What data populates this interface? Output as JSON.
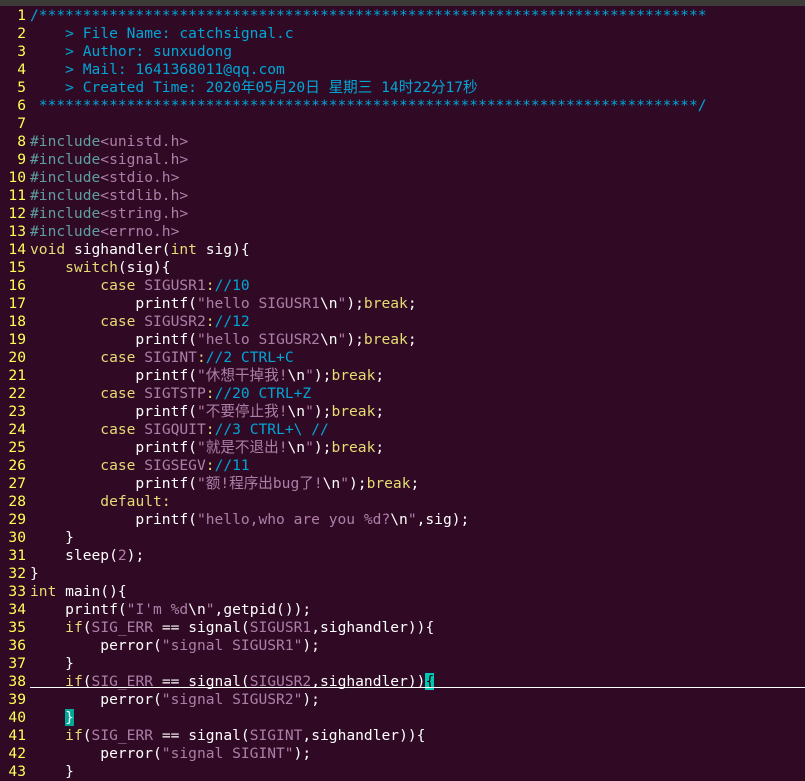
{
  "editor": {
    "lines": [
      {
        "n": "1",
        "tokens": [
          {
            "t": "/****************************************************************************",
            "c": "c"
          }
        ]
      },
      {
        "n": "2",
        "tokens": [
          {
            "t": "    > File Name: catchsignal.c",
            "c": "c"
          }
        ]
      },
      {
        "n": "3",
        "tokens": [
          {
            "t": "    > Author: sunxudong",
            "c": "c"
          }
        ]
      },
      {
        "n": "4",
        "tokens": [
          {
            "t": "    > Mail: 1641368011@qq.com",
            "c": "c"
          }
        ]
      },
      {
        "n": "5",
        "tokens": [
          {
            "t": "    > Created Time: 2020年05月20日 星期三 14时22分17秒",
            "c": "c"
          }
        ]
      },
      {
        "n": "6",
        "tokens": [
          {
            "t": " ***************************************************************************/",
            "c": "c"
          }
        ]
      },
      {
        "n": "7",
        "tokens": []
      },
      {
        "n": "8",
        "tokens": [
          {
            "t": "#include",
            "c": "p"
          },
          {
            "t": "<unistd.h>",
            "c": "s"
          }
        ]
      },
      {
        "n": "9",
        "tokens": [
          {
            "t": "#include",
            "c": "p"
          },
          {
            "t": "<signal.h>",
            "c": "s"
          }
        ]
      },
      {
        "n": "10",
        "tokens": [
          {
            "t": "#include",
            "c": "p"
          },
          {
            "t": "<stdio.h>",
            "c": "s"
          }
        ]
      },
      {
        "n": "11",
        "tokens": [
          {
            "t": "#include",
            "c": "p"
          },
          {
            "t": "<stdlib.h>",
            "c": "s"
          }
        ]
      },
      {
        "n": "12",
        "tokens": [
          {
            "t": "#include",
            "c": "p"
          },
          {
            "t": "<string.h>",
            "c": "s"
          }
        ]
      },
      {
        "n": "13",
        "tokens": [
          {
            "t": "#include",
            "c": "p"
          },
          {
            "t": "<errno.h>",
            "c": "s"
          }
        ]
      },
      {
        "n": "14",
        "tokens": [
          {
            "t": "void",
            "c": "k"
          },
          {
            "t": " sighandler(",
            "c": ""
          },
          {
            "t": "int",
            "c": "k"
          },
          {
            "t": " sig){",
            "c": ""
          }
        ]
      },
      {
        "n": "15",
        "tokens": [
          {
            "t": "    ",
            "c": ""
          },
          {
            "t": "switch",
            "c": "k"
          },
          {
            "t": "(sig){",
            "c": ""
          }
        ]
      },
      {
        "n": "16",
        "tokens": [
          {
            "t": "        ",
            "c": ""
          },
          {
            "t": "case",
            "c": "k"
          },
          {
            "t": " ",
            "c": ""
          },
          {
            "t": "SIGUSR1",
            "c": "s"
          },
          {
            "t": ":",
            "c": "k"
          },
          {
            "t": "//10",
            "c": "c"
          }
        ]
      },
      {
        "n": "17",
        "tokens": [
          {
            "t": "            printf(",
            "c": ""
          },
          {
            "t": "\"hello SIGUSR1",
            "c": "s"
          },
          {
            "t": "\\n",
            "c": ""
          },
          {
            "t": "\"",
            "c": "s"
          },
          {
            "t": ");",
            "c": ""
          },
          {
            "t": "break",
            "c": "k"
          },
          {
            "t": ";",
            "c": ""
          }
        ]
      },
      {
        "n": "18",
        "tokens": [
          {
            "t": "        ",
            "c": ""
          },
          {
            "t": "case",
            "c": "k"
          },
          {
            "t": " ",
            "c": ""
          },
          {
            "t": "SIGUSR2",
            "c": "s"
          },
          {
            "t": ":",
            "c": "k"
          },
          {
            "t": "//12",
            "c": "c"
          }
        ]
      },
      {
        "n": "19",
        "tokens": [
          {
            "t": "            printf(",
            "c": ""
          },
          {
            "t": "\"hello SIGUSR2",
            "c": "s"
          },
          {
            "t": "\\n",
            "c": ""
          },
          {
            "t": "\"",
            "c": "s"
          },
          {
            "t": ");",
            "c": ""
          },
          {
            "t": "break",
            "c": "k"
          },
          {
            "t": ";",
            "c": ""
          }
        ]
      },
      {
        "n": "20",
        "tokens": [
          {
            "t": "        ",
            "c": ""
          },
          {
            "t": "case",
            "c": "k"
          },
          {
            "t": " ",
            "c": ""
          },
          {
            "t": "SIGINT",
            "c": "s"
          },
          {
            "t": ":",
            "c": "k"
          },
          {
            "t": "//2 CTRL+C",
            "c": "c"
          }
        ]
      },
      {
        "n": "21",
        "tokens": [
          {
            "t": "            printf(",
            "c": ""
          },
          {
            "t": "\"休想干掉我!",
            "c": "s"
          },
          {
            "t": "\\n",
            "c": ""
          },
          {
            "t": "\"",
            "c": "s"
          },
          {
            "t": ");",
            "c": ""
          },
          {
            "t": "break",
            "c": "k"
          },
          {
            "t": ";",
            "c": ""
          }
        ]
      },
      {
        "n": "22",
        "tokens": [
          {
            "t": "        ",
            "c": ""
          },
          {
            "t": "case",
            "c": "k"
          },
          {
            "t": " ",
            "c": ""
          },
          {
            "t": "SIGTSTP",
            "c": "s"
          },
          {
            "t": ":",
            "c": "k"
          },
          {
            "t": "//20 CTRL+Z",
            "c": "c"
          }
        ]
      },
      {
        "n": "23",
        "tokens": [
          {
            "t": "            printf(",
            "c": ""
          },
          {
            "t": "\"不要停止我!",
            "c": "s"
          },
          {
            "t": "\\n",
            "c": ""
          },
          {
            "t": "\"",
            "c": "s"
          },
          {
            "t": ");",
            "c": ""
          },
          {
            "t": "break",
            "c": "k"
          },
          {
            "t": ";",
            "c": ""
          }
        ]
      },
      {
        "n": "24",
        "tokens": [
          {
            "t": "        ",
            "c": ""
          },
          {
            "t": "case",
            "c": "k"
          },
          {
            "t": " ",
            "c": ""
          },
          {
            "t": "SIGQUIT",
            "c": "s"
          },
          {
            "t": ":",
            "c": "k"
          },
          {
            "t": "//3 CTRL+\\ //",
            "c": "c"
          }
        ]
      },
      {
        "n": "25",
        "tokens": [
          {
            "t": "            printf(",
            "c": ""
          },
          {
            "t": "\"就是不退出!",
            "c": "s"
          },
          {
            "t": "\\n",
            "c": ""
          },
          {
            "t": "\"",
            "c": "s"
          },
          {
            "t": ");",
            "c": ""
          },
          {
            "t": "break",
            "c": "k"
          },
          {
            "t": ";",
            "c": ""
          }
        ]
      },
      {
        "n": "26",
        "tokens": [
          {
            "t": "        ",
            "c": ""
          },
          {
            "t": "case",
            "c": "k"
          },
          {
            "t": " ",
            "c": ""
          },
          {
            "t": "SIGSEGV",
            "c": "s"
          },
          {
            "t": ":",
            "c": "k"
          },
          {
            "t": "//11",
            "c": "c"
          }
        ]
      },
      {
        "n": "27",
        "tokens": [
          {
            "t": "            printf(",
            "c": ""
          },
          {
            "t": "\"额!程序出bug了!",
            "c": "s"
          },
          {
            "t": "\\n",
            "c": ""
          },
          {
            "t": "\"",
            "c": "s"
          },
          {
            "t": ");",
            "c": ""
          },
          {
            "t": "break",
            "c": "k"
          },
          {
            "t": ";",
            "c": ""
          }
        ]
      },
      {
        "n": "28",
        "tokens": [
          {
            "t": "        ",
            "c": ""
          },
          {
            "t": "default",
            "c": "k"
          },
          {
            "t": ":",
            "c": "k"
          }
        ]
      },
      {
        "n": "29",
        "tokens": [
          {
            "t": "            printf(",
            "c": ""
          },
          {
            "t": "\"hello,who are you %d?",
            "c": "s"
          },
          {
            "t": "\\n",
            "c": ""
          },
          {
            "t": "\"",
            "c": "s"
          },
          {
            "t": ",sig);",
            "c": ""
          }
        ]
      },
      {
        "n": "30",
        "tokens": [
          {
            "t": "    }",
            "c": ""
          }
        ]
      },
      {
        "n": "31",
        "tokens": [
          {
            "t": "    sleep(",
            "c": ""
          },
          {
            "t": "2",
            "c": "n"
          },
          {
            "t": ");",
            "c": ""
          }
        ]
      },
      {
        "n": "32",
        "tokens": [
          {
            "t": "}",
            "c": ""
          }
        ]
      },
      {
        "n": "33",
        "tokens": [
          {
            "t": "int",
            "c": "k"
          },
          {
            "t": " main(){",
            "c": ""
          }
        ]
      },
      {
        "n": "34",
        "tokens": [
          {
            "t": "    printf(",
            "c": ""
          },
          {
            "t": "\"I'm %d",
            "c": "s"
          },
          {
            "t": "\\n",
            "c": ""
          },
          {
            "t": "\"",
            "c": "s"
          },
          {
            "t": ",getpid());",
            "c": ""
          }
        ]
      },
      {
        "n": "35",
        "tokens": [
          {
            "t": "    ",
            "c": ""
          },
          {
            "t": "if",
            "c": "k"
          },
          {
            "t": "(",
            "c": ""
          },
          {
            "t": "SIG_ERR",
            "c": "s"
          },
          {
            "t": " == signal(",
            "c": ""
          },
          {
            "t": "SIGUSR1",
            "c": "s"
          },
          {
            "t": ",sighandler)){",
            "c": ""
          }
        ]
      },
      {
        "n": "36",
        "tokens": [
          {
            "t": "        perror(",
            "c": ""
          },
          {
            "t": "\"signal SIGUSR1\"",
            "c": "s"
          },
          {
            "t": ");",
            "c": ""
          }
        ]
      },
      {
        "n": "37",
        "tokens": [
          {
            "t": "    }",
            "c": ""
          }
        ]
      },
      {
        "n": "38",
        "tokens": [
          {
            "t": "    ",
            "c": ""
          },
          {
            "t": "if",
            "c": "k"
          },
          {
            "t": "(",
            "c": ""
          },
          {
            "t": "SIG_ERR",
            "c": "s"
          },
          {
            "t": " == signal(",
            "c": ""
          },
          {
            "t": "SIGUSR2",
            "c": "s"
          },
          {
            "t": ",sighandler))",
            "c": ""
          },
          {
            "t": "{",
            "c": "cursor"
          }
        ]
      },
      {
        "n": "39",
        "tokens": [
          {
            "t": "        perror(",
            "c": ""
          },
          {
            "t": "\"signal SIGUSR2\"",
            "c": "s"
          },
          {
            "t": ");",
            "c": ""
          }
        ]
      },
      {
        "n": "40",
        "tokens": [
          {
            "t": "    ",
            "c": ""
          },
          {
            "t": "}",
            "c": "match"
          }
        ]
      },
      {
        "n": "41",
        "tokens": [
          {
            "t": "    ",
            "c": ""
          },
          {
            "t": "if",
            "c": "k"
          },
          {
            "t": "(",
            "c": ""
          },
          {
            "t": "SIG_ERR",
            "c": "s"
          },
          {
            "t": " == signal(",
            "c": ""
          },
          {
            "t": "SIGINT",
            "c": "s"
          },
          {
            "t": ",sighandler)){",
            "c": ""
          }
        ]
      },
      {
        "n": "42",
        "tokens": [
          {
            "t": "        perror(",
            "c": ""
          },
          {
            "t": "\"signal SIGINT\"",
            "c": "s"
          },
          {
            "t": ");",
            "c": ""
          }
        ]
      },
      {
        "n": "43",
        "tokens": [
          {
            "t": "    }",
            "c": ""
          }
        ]
      }
    ]
  },
  "colors": {
    "background": "#300a24",
    "line_number": "#ffff55",
    "comment": "#00a6d6",
    "string": "#ad7fa8",
    "keyword": "#e6db74",
    "cursor": "#00c8b4"
  }
}
